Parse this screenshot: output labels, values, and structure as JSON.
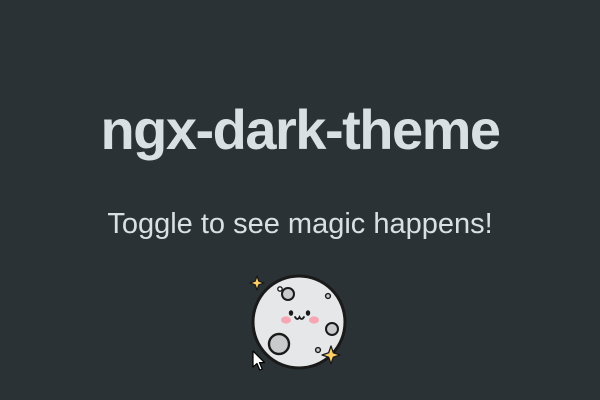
{
  "header": {
    "title": "ngx-dark-theme"
  },
  "main": {
    "subtitle": "Toggle to see magic happens!"
  },
  "toggle": {
    "icon": "moon-icon",
    "state": "dark"
  },
  "colors": {
    "background": "#2b3235",
    "text": "#d9e0e3",
    "moon": "#e6e7e8",
    "crater": "#c9cacc",
    "blush": "#f6a6b2",
    "sparkle": "#ffd166"
  }
}
